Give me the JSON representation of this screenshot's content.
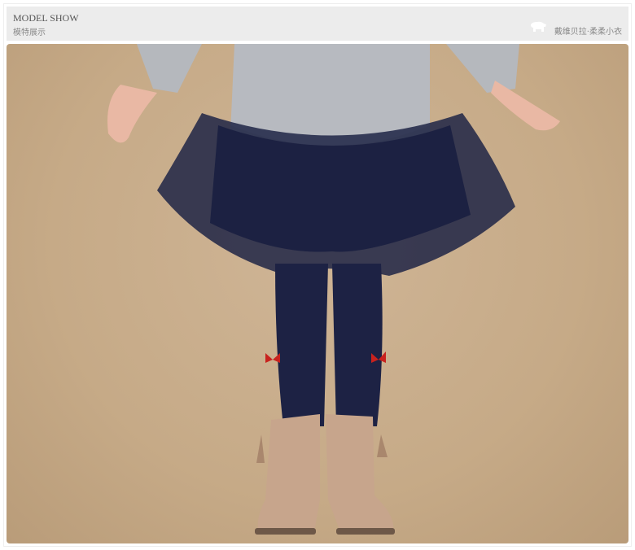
{
  "header": {
    "title_en": "MODEL SHOW",
    "title_cn": "模特展示",
    "brand_text": "戴维贝拉·柔柔小衣",
    "brand_icon": "elephant-icon"
  },
  "photo": {
    "subject": "model-photo",
    "background_color": "#c6aa87"
  }
}
